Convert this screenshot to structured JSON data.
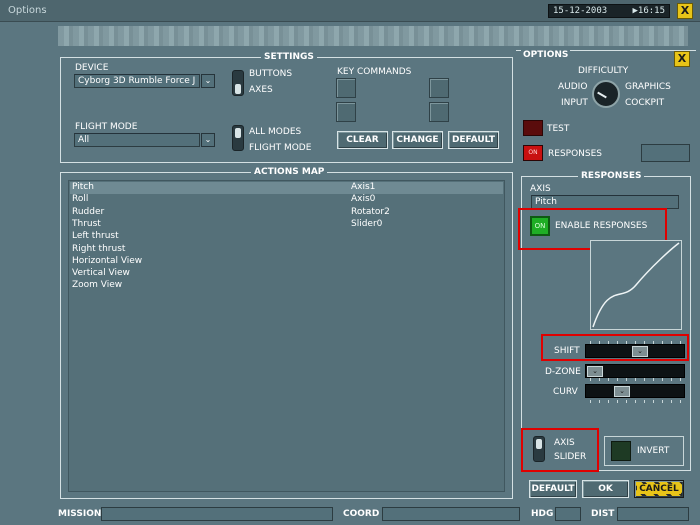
{
  "window": {
    "title": "Options",
    "date": "15-12-2003",
    "time": "16:15",
    "close_label": "X"
  },
  "settings": {
    "title": "SETTINGS",
    "device_label": "DEVICE",
    "device_value": "Cyborg 3D Rumble Force J",
    "buttons_label": "BUTTONS",
    "axes_label": "AXES",
    "flight_mode_label": "FLIGHT MODE",
    "flight_mode_value": "All",
    "all_modes_label": "ALL MODES",
    "flight_mode_option_label": "FLIGHT MODE",
    "key_commands_label": "KEY COMMANDS",
    "clear_label": "CLEAR",
    "change_label": "CHANGE",
    "default_label": "DEFAULT"
  },
  "actions_map": {
    "title": "ACTIONS MAP",
    "rows": [
      {
        "action": "Pitch",
        "binding": "Axis1"
      },
      {
        "action": "Roll",
        "binding": "Axis0"
      },
      {
        "action": "Rudder",
        "binding": "Rotator2"
      },
      {
        "action": "Thrust",
        "binding": "Slider0"
      },
      {
        "action": "Left thrust",
        "binding": ""
      },
      {
        "action": "Right thrust",
        "binding": ""
      },
      {
        "action": "Horizontal View",
        "binding": ""
      },
      {
        "action": "Vertical View",
        "binding": ""
      },
      {
        "action": "Zoom View",
        "binding": ""
      }
    ],
    "selected_index": 0
  },
  "options": {
    "title": "OPTIONS",
    "close_label": "X",
    "difficulty_label": "DIFFICULTY",
    "audio_label": "AUDIO",
    "graphics_label": "GRAPHICS",
    "input_label": "INPUT",
    "cockpit_label": "COCKPIT",
    "test_label": "TEST",
    "responses_label": "RESPONSES",
    "led_on_label": "ON"
  },
  "responses": {
    "title": "RESPONSES",
    "axis_label": "AXIS",
    "axis_value": "Pitch",
    "enable_responses_label": "ENABLE RESPONSES",
    "enable_led_label": "ON",
    "shift_label": "SHIFT",
    "dzone_label": "D-ZONE",
    "curv_label": "CURV",
    "shift_value": 0.55,
    "dzone_value": 0.0,
    "curv_value": 0.33,
    "axis_option_label": "AXIS",
    "slider_option_label": "SLIDER",
    "invert_label": "INVERT"
  },
  "footer": {
    "default_label": "DEFAULT",
    "ok_label": "OK",
    "cancel_label": "CANCEL",
    "mission_label": "MISSION",
    "coord_label": "COORD",
    "hdg_label": "HDG",
    "dist_label": "DIST"
  },
  "colors": {
    "highlight": "#e00000",
    "led_green": "#1fae25",
    "led_red": "#c81010",
    "cancel_yellow": "#e8c418"
  }
}
